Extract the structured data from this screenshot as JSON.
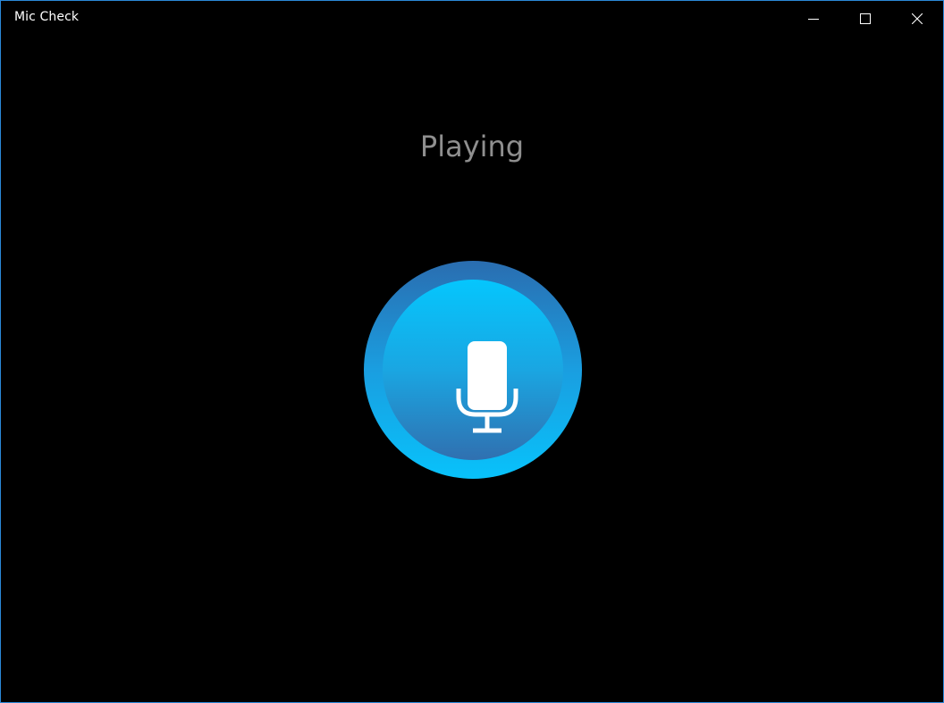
{
  "window": {
    "title": "Mic Check",
    "controls": {
      "minimize_icon": "minimize-icon",
      "maximize_icon": "maximize-icon",
      "close_icon": "close-icon"
    }
  },
  "main": {
    "status": "Playing",
    "mic_button": {
      "icon": "microphone-icon",
      "accent_outer_top": "#2a6db0",
      "accent_outer_bottom": "#08c2fb",
      "accent_inner_top": "#05c6fd",
      "accent_inner_bottom": "#3070b0"
    }
  },
  "colors": {
    "background": "#000000",
    "window_border": "#2b88d8",
    "status_text": "#8f8f8f"
  }
}
